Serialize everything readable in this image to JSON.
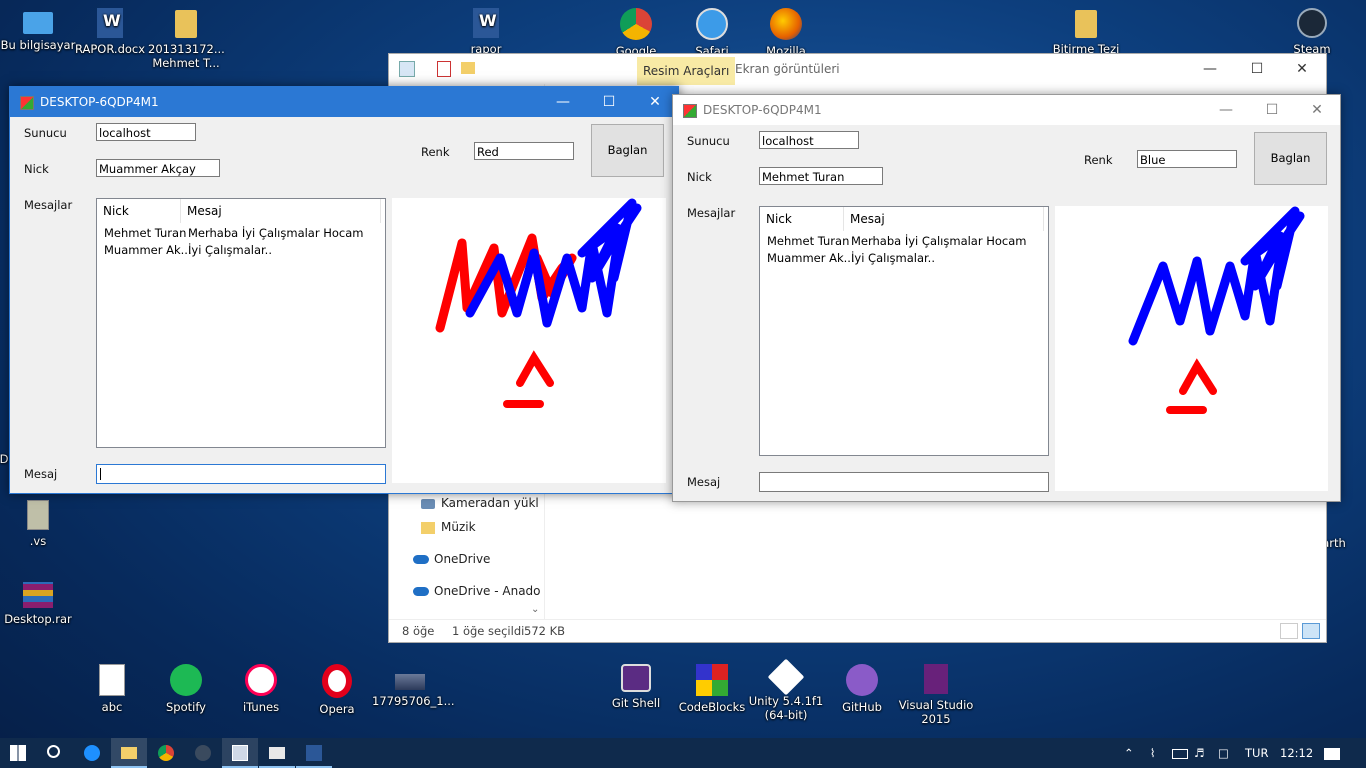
{
  "desktop_icons": {
    "pc": "Bu bilgisayar",
    "rapor_docx": "RAPOR.docx",
    "student_line1": "201313172...",
    "student_line2": "Mehmet T...",
    "rapor": "rapor",
    "google": "Google",
    "safari": "Safari",
    "mozilla": "Mozilla",
    "bitirme": "Bitirme Tezi",
    "steam": "Steam",
    "vs_folder": ".vs",
    "desktop_rar": "Desktop.rar",
    "abc": "abc",
    "spotify": "Spotify",
    "itunes": "iTunes",
    "opera": "Opera",
    "img_file": "17795706_1...",
    "git_shell": "Git Shell",
    "codeblocks": "CodeBlocks",
    "unity_line1": "Unity 5.4.1f1",
    "unity_line2": "(64-bit)",
    "github": "GitHub",
    "vs2015_line1": "Visual Studio",
    "vs2015_line2": "2015",
    "partial_d": "D",
    "partial_earth": "arth"
  },
  "explorer": {
    "ribbon_tab": "Resim Araçları",
    "title": "Ekran görüntüleri",
    "nav": [
      "Kameradan yükl",
      "Müzik",
      "OneDrive",
      "OneDrive - Anado"
    ],
    "status_count": "8 öğe",
    "status_selected": "1 öğe seçildi",
    "status_size": "572 KB"
  },
  "app1": {
    "title": "DESKTOP-6QDP4M1",
    "sunucu_label": "Sunucu",
    "sunucu_value": "localhost",
    "nick_label": "Nick",
    "nick_value": "Muammer Akçay",
    "renk_label": "Renk",
    "renk_value": "Red",
    "connect_button": "Baglan",
    "mesajlar_label": "Mesajlar",
    "col_nick": "Nick",
    "col_mesaj": "Mesaj",
    "rows": [
      {
        "nick": "Mehmet Turan",
        "mesaj": "Merhaba İyi Çalışmalar Hocam"
      },
      {
        "nick": "Muammer Ak...",
        "mesaj": "İyi Çalışmalar.."
      }
    ],
    "mesaj_label": "Mesaj",
    "mesaj_value": ""
  },
  "app2": {
    "title": "DESKTOP-6QDP4M1",
    "sunucu_label": "Sunucu",
    "sunucu_value": "localhost",
    "nick_label": "Nick",
    "nick_value": "Mehmet Turan",
    "renk_label": "Renk",
    "renk_value": "Blue",
    "connect_button": "Baglan",
    "mesajlar_label": "Mesajlar",
    "col_nick": "Nick",
    "col_mesaj": "Mesaj",
    "rows": [
      {
        "nick": "Mehmet Turan",
        "mesaj": "Merhaba İyi Çalışmalar Hocam"
      },
      {
        "nick": "Muammer Ak...",
        "mesaj": "İyi Çalışmalar.."
      }
    ],
    "mesaj_label": "Mesaj",
    "mesaj_value": ""
  },
  "taskbar": {
    "language": "TUR",
    "time": "12:12"
  },
  "colors": {
    "accent": "#2b78d4",
    "stroke_red": "#ff0000",
    "stroke_blue": "#0000ff"
  }
}
